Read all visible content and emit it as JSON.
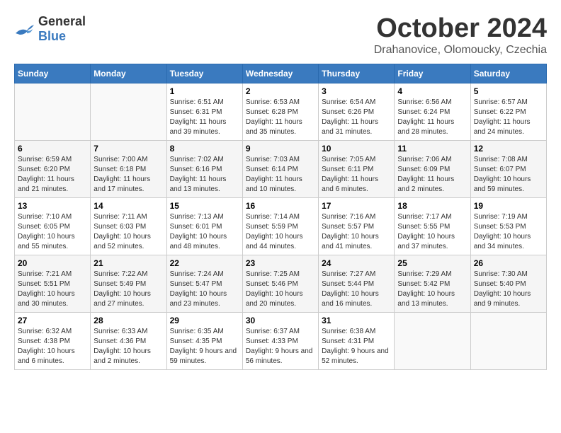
{
  "logo": {
    "general": "General",
    "blue": "Blue"
  },
  "title": "October 2024",
  "location": "Drahanovice, Olomoucky, Czechia",
  "days_header": [
    "Sunday",
    "Monday",
    "Tuesday",
    "Wednesday",
    "Thursday",
    "Friday",
    "Saturday"
  ],
  "weeks": [
    [
      {
        "day": "",
        "info": ""
      },
      {
        "day": "",
        "info": ""
      },
      {
        "day": "1",
        "info": "Sunrise: 6:51 AM\nSunset: 6:31 PM\nDaylight: 11 hours and 39 minutes."
      },
      {
        "day": "2",
        "info": "Sunrise: 6:53 AM\nSunset: 6:28 PM\nDaylight: 11 hours and 35 minutes."
      },
      {
        "day": "3",
        "info": "Sunrise: 6:54 AM\nSunset: 6:26 PM\nDaylight: 11 hours and 31 minutes."
      },
      {
        "day": "4",
        "info": "Sunrise: 6:56 AM\nSunset: 6:24 PM\nDaylight: 11 hours and 28 minutes."
      },
      {
        "day": "5",
        "info": "Sunrise: 6:57 AM\nSunset: 6:22 PM\nDaylight: 11 hours and 24 minutes."
      }
    ],
    [
      {
        "day": "6",
        "info": "Sunrise: 6:59 AM\nSunset: 6:20 PM\nDaylight: 11 hours and 21 minutes."
      },
      {
        "day": "7",
        "info": "Sunrise: 7:00 AM\nSunset: 6:18 PM\nDaylight: 11 hours and 17 minutes."
      },
      {
        "day": "8",
        "info": "Sunrise: 7:02 AM\nSunset: 6:16 PM\nDaylight: 11 hours and 13 minutes."
      },
      {
        "day": "9",
        "info": "Sunrise: 7:03 AM\nSunset: 6:14 PM\nDaylight: 11 hours and 10 minutes."
      },
      {
        "day": "10",
        "info": "Sunrise: 7:05 AM\nSunset: 6:11 PM\nDaylight: 11 hours and 6 minutes."
      },
      {
        "day": "11",
        "info": "Sunrise: 7:06 AM\nSunset: 6:09 PM\nDaylight: 11 hours and 2 minutes."
      },
      {
        "day": "12",
        "info": "Sunrise: 7:08 AM\nSunset: 6:07 PM\nDaylight: 10 hours and 59 minutes."
      }
    ],
    [
      {
        "day": "13",
        "info": "Sunrise: 7:10 AM\nSunset: 6:05 PM\nDaylight: 10 hours and 55 minutes."
      },
      {
        "day": "14",
        "info": "Sunrise: 7:11 AM\nSunset: 6:03 PM\nDaylight: 10 hours and 52 minutes."
      },
      {
        "day": "15",
        "info": "Sunrise: 7:13 AM\nSunset: 6:01 PM\nDaylight: 10 hours and 48 minutes."
      },
      {
        "day": "16",
        "info": "Sunrise: 7:14 AM\nSunset: 5:59 PM\nDaylight: 10 hours and 44 minutes."
      },
      {
        "day": "17",
        "info": "Sunrise: 7:16 AM\nSunset: 5:57 PM\nDaylight: 10 hours and 41 minutes."
      },
      {
        "day": "18",
        "info": "Sunrise: 7:17 AM\nSunset: 5:55 PM\nDaylight: 10 hours and 37 minutes."
      },
      {
        "day": "19",
        "info": "Sunrise: 7:19 AM\nSunset: 5:53 PM\nDaylight: 10 hours and 34 minutes."
      }
    ],
    [
      {
        "day": "20",
        "info": "Sunrise: 7:21 AM\nSunset: 5:51 PM\nDaylight: 10 hours and 30 minutes."
      },
      {
        "day": "21",
        "info": "Sunrise: 7:22 AM\nSunset: 5:49 PM\nDaylight: 10 hours and 27 minutes."
      },
      {
        "day": "22",
        "info": "Sunrise: 7:24 AM\nSunset: 5:47 PM\nDaylight: 10 hours and 23 minutes."
      },
      {
        "day": "23",
        "info": "Sunrise: 7:25 AM\nSunset: 5:46 PM\nDaylight: 10 hours and 20 minutes."
      },
      {
        "day": "24",
        "info": "Sunrise: 7:27 AM\nSunset: 5:44 PM\nDaylight: 10 hours and 16 minutes."
      },
      {
        "day": "25",
        "info": "Sunrise: 7:29 AM\nSunset: 5:42 PM\nDaylight: 10 hours and 13 minutes."
      },
      {
        "day": "26",
        "info": "Sunrise: 7:30 AM\nSunset: 5:40 PM\nDaylight: 10 hours and 9 minutes."
      }
    ],
    [
      {
        "day": "27",
        "info": "Sunrise: 6:32 AM\nSunset: 4:38 PM\nDaylight: 10 hours and 6 minutes."
      },
      {
        "day": "28",
        "info": "Sunrise: 6:33 AM\nSunset: 4:36 PM\nDaylight: 10 hours and 2 minutes."
      },
      {
        "day": "29",
        "info": "Sunrise: 6:35 AM\nSunset: 4:35 PM\nDaylight: 9 hours and 59 minutes."
      },
      {
        "day": "30",
        "info": "Sunrise: 6:37 AM\nSunset: 4:33 PM\nDaylight: 9 hours and 56 minutes."
      },
      {
        "day": "31",
        "info": "Sunrise: 6:38 AM\nSunset: 4:31 PM\nDaylight: 9 hours and 52 minutes."
      },
      {
        "day": "",
        "info": ""
      },
      {
        "day": "",
        "info": ""
      }
    ]
  ]
}
